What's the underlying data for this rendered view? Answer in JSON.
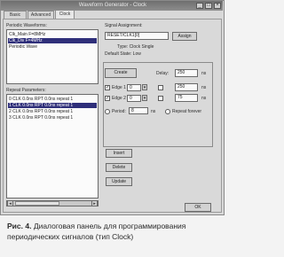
{
  "window": {
    "title": "Waveform Generator - Clock"
  },
  "tabs": [
    "Basic",
    "Advanced",
    "Clock"
  ],
  "periodic_section": {
    "label": "Periodic Waveforms:",
    "items": [
      "Clk_Main  F=8MHz",
      "Clk_Div  F=4MHz",
      "Periodic Wave"
    ]
  },
  "assignment": {
    "label": "Signal Assignment:",
    "value": "RESET/CLK1[0]",
    "button": "Assign"
  },
  "info_lines": [
    "Type: Clock Single",
    "Default State: Low"
  ],
  "create_button": "Create",
  "delay": {
    "label": "Delay:",
    "value": "250",
    "unit": "ns"
  },
  "edge_rows": [
    {
      "label": "Edge 1",
      "value": "0",
      "field": "250",
      "unit": "ns"
    },
    {
      "label": "Edge 2",
      "value": "0",
      "field": "75",
      "unit": "ns"
    }
  ],
  "period": {
    "label": "Period:",
    "value": "8",
    "unit": "ns",
    "radio2_label": "Repeat forever"
  },
  "repeat_section": {
    "label": "Repeat Parameters:",
    "items": [
      "0  CLK 0.0ns RPT 0.0ns repeat 1",
      "1  CLK 0.0ns RPT 0.0ns repeat 1",
      "2  CLK 0.0ns RPT 0.0ns repeat 1",
      "3  CLK 0.0ns RPT 0.0ns repeat 1"
    ]
  },
  "action_buttons": [
    "Insert",
    "Delete",
    "Update"
  ],
  "ok_button": "OK",
  "caption": {
    "prefix": "Рис. 4.",
    "text": "Диалоговая панель для программирования периодических сигналов (тип Clock)"
  }
}
